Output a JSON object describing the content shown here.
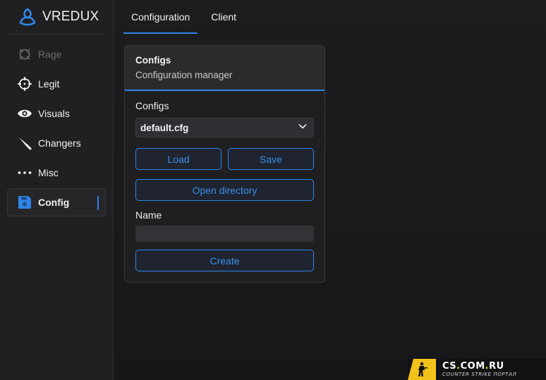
{
  "brand": {
    "name": "VREDUX",
    "logo_icon": "vredux-triskelion-icon",
    "accent": "#2f86e6"
  },
  "sidebar": {
    "items": [
      {
        "label": "Rage",
        "icon": "rage-target-icon",
        "disabled": true,
        "active": false
      },
      {
        "label": "Legit",
        "icon": "crosshair-icon",
        "disabled": false,
        "active": false
      },
      {
        "label": "Visuals",
        "icon": "eye-icon",
        "disabled": false,
        "active": false
      },
      {
        "label": "Changers",
        "icon": "knife-icon",
        "disabled": false,
        "active": false
      },
      {
        "label": "Misc",
        "icon": "ellipsis-icon",
        "disabled": false,
        "active": false
      },
      {
        "label": "Config",
        "icon": "save-disk-icon",
        "disabled": false,
        "active": true
      }
    ]
  },
  "tabs": [
    {
      "label": "Configuration",
      "active": true
    },
    {
      "label": "Client",
      "active": false
    }
  ],
  "card": {
    "title": "Configs",
    "subtitle": "Configuration manager",
    "configs_label": "Configs",
    "selected_config": "default.cfg",
    "load_label": "Load",
    "save_label": "Save",
    "open_dir_label": "Open directory",
    "name_label": "Name",
    "name_value": "",
    "create_label": "Create"
  },
  "watermark": {
    "site_a": "CS",
    "site_b": "COM",
    "site_c": "RU",
    "tagline": "COUNTER STRIKE ПОРТАЛ"
  },
  "colors": {
    "accent": "#2f86e6",
    "background": "#1b1b1d",
    "sidebar": "#202022",
    "watermark_yellow": "#f2c218"
  }
}
